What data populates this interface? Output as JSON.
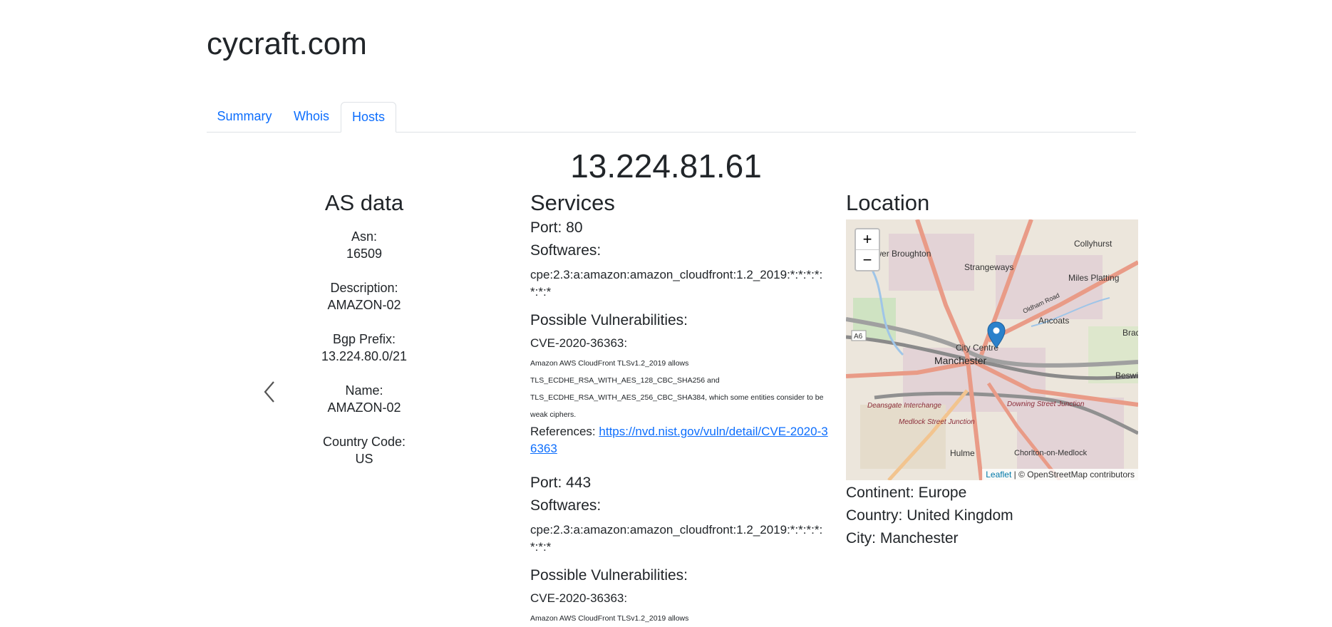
{
  "site": {
    "title": "cycraft.com"
  },
  "tabs": [
    {
      "label": "Summary"
    },
    {
      "label": "Whois"
    },
    {
      "label": "Hosts"
    }
  ],
  "host": {
    "ip": "13.224.81.61",
    "as_data": {
      "heading": "AS data",
      "items": [
        {
          "label": "Asn:",
          "value": "16509"
        },
        {
          "label": "Description:",
          "value": "AMAZON-02"
        },
        {
          "label": "Bgp Prefix:",
          "value": "13.224.80.0/21"
        },
        {
          "label": "Name:",
          "value": "AMAZON-02"
        },
        {
          "label": "Country Code:",
          "value": "US"
        }
      ]
    },
    "services": {
      "heading": "Services",
      "entries": [
        {
          "port": "Port: 80",
          "softwares_label": "Softwares:",
          "cpe": "cpe:2.3:a:amazon:amazon_cloudfront:1.2_2019:*:*:*:*:*:*:*",
          "vuln_label": "Possible Vulnerabilities:",
          "cve": "CVE-2020-36363:",
          "desc": "Amazon AWS CloudFront TLSv1.2_2019 allows TLS_ECDHE_RSA_WITH_AES_128_CBC_SHA256 and TLS_ECDHE_RSA_WITH_AES_256_CBC_SHA384, which some entities consider to be weak ciphers.",
          "refs_label": "References: ",
          "ref_url": "https://nvd.nist.gov/vuln/detail/CVE-2020-36363"
        },
        {
          "port": "Port: 443",
          "softwares_label": "Softwares:",
          "cpe": "cpe:2.3:a:amazon:amazon_cloudfront:1.2_2019:*:*:*:*:*:*:*",
          "vuln_label": "Possible Vulnerabilities:",
          "cve": "CVE-2020-36363:",
          "desc": "Amazon AWS CloudFront TLSv1.2_2019 allows"
        }
      ]
    },
    "location": {
      "heading": "Location",
      "map": {
        "zoom_in": "+",
        "zoom_out": "−",
        "labels": [
          "Collyhurst",
          "Lower Broughton",
          "Strangeways",
          "Miles Platting",
          "Ancoats",
          "City Centre",
          "Manchester",
          "Deansgate Interchange",
          "Downing Street Junction",
          "Medlock Street Junction",
          "Hulme",
          "Chorlton-on-Medlock",
          "Oldham Road",
          "Bradford",
          "Beswick",
          "A6"
        ],
        "attribution_link": "Leaflet",
        "attribution_text": " | © OpenStreetMap contributors"
      },
      "continent": "Continent: Europe",
      "country": "Country: United Kingdom",
      "city": "City: Manchester"
    }
  },
  "colors": {
    "link": "#0d6efd",
    "marker": "#2a81cb"
  }
}
